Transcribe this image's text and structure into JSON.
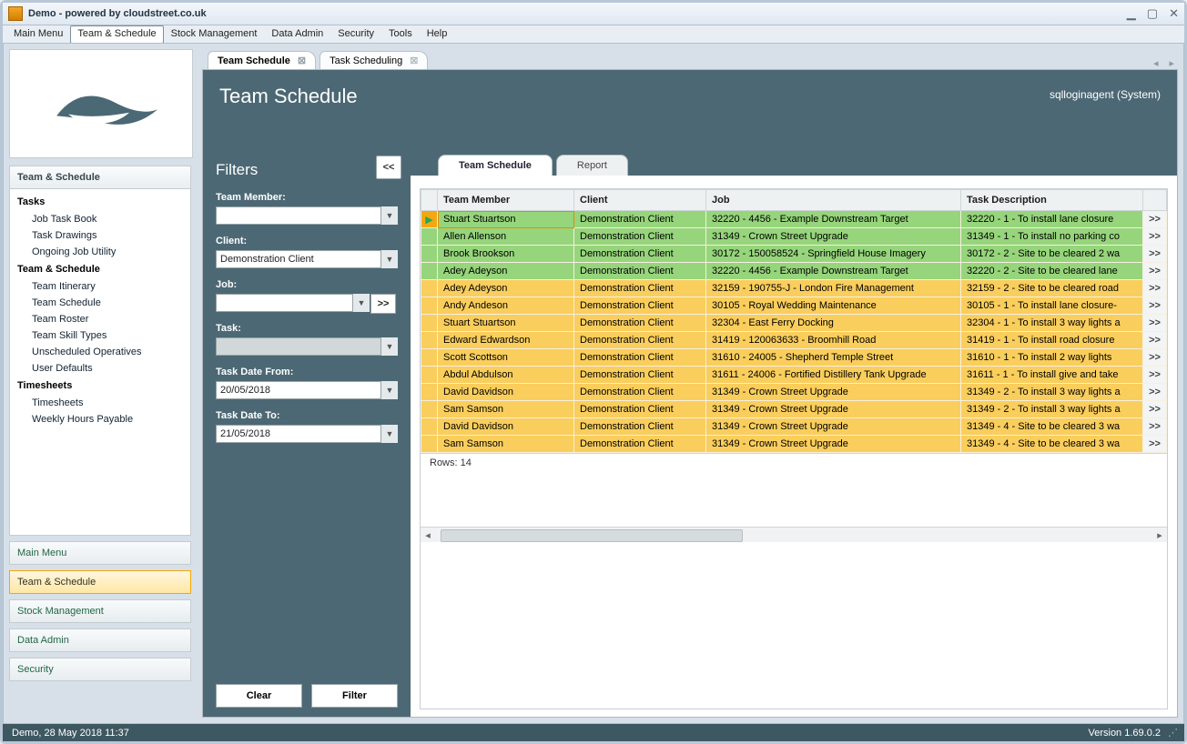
{
  "window": {
    "title": "Demo - powered by cloudstreet.co.uk"
  },
  "menubar": [
    "Main Menu",
    "Team & Schedule",
    "Stock Management",
    "Data Admin",
    "Security",
    "Tools",
    "Help"
  ],
  "menubar_active_index": 1,
  "doc_tabs": [
    {
      "label": "Team Schedule",
      "active": true
    },
    {
      "label": "Task Scheduling",
      "active": false
    }
  ],
  "page": {
    "title": "Team Schedule",
    "user": "sqlloginagent (System)"
  },
  "nav": {
    "header": "Team & Schedule",
    "groups": [
      {
        "title": "Tasks",
        "items": [
          "Job Task Book",
          "Task Drawings",
          "Ongoing Job Utility"
        ]
      },
      {
        "title": "Team & Schedule",
        "items": [
          "Team Itinerary",
          "Team Schedule",
          "Team Roster",
          "Team Skill Types",
          "Unscheduled Operatives",
          "User Defaults"
        ]
      },
      {
        "title": "Timesheets",
        "items": [
          "Timesheets",
          "Weekly Hours Payable"
        ]
      }
    ],
    "bottom": [
      {
        "label": "Main Menu",
        "selected": false
      },
      {
        "label": "Team & Schedule",
        "selected": true
      },
      {
        "label": "Stock Management",
        "selected": false
      },
      {
        "label": "Data Admin",
        "selected": false
      },
      {
        "label": "Security",
        "selected": false
      }
    ]
  },
  "filters": {
    "title": "Filters",
    "collapse": "<<",
    "team_member_label": "Team Member:",
    "team_member": "",
    "client_label": "Client:",
    "client": "Demonstration Client",
    "job_label": "Job:",
    "job": "",
    "job_go": ">>",
    "task_label": "Task:",
    "task": "",
    "date_from_label": "Task Date From:",
    "date_from": "20/05/2018",
    "date_to_label": "Task Date To:",
    "date_to": "21/05/2018",
    "clear": "Clear",
    "apply": "Filter"
  },
  "inner_tabs": [
    "Team Schedule",
    "Report"
  ],
  "grid": {
    "columns": [
      "",
      "Team Member",
      "Client",
      "Job",
      "Task Description",
      ""
    ],
    "rows": [
      {
        "c": "green",
        "sel": true,
        "tm": "Stuart Stuartson",
        "cl": "Demonstration Client",
        "job": "32220 - 4456 - Example Downstream Target",
        "td": "32220 - 1 - To install lane closure"
      },
      {
        "c": "green",
        "tm": "Allen Allenson",
        "cl": "Demonstration Client",
        "job": "31349 - Crown Street Upgrade",
        "td": "31349 - 1 - To install no parking co"
      },
      {
        "c": "green",
        "tm": "Brook Brookson",
        "cl": "Demonstration Client",
        "job": "30172 - 150058524 - Springfield House Imagery",
        "td": "30172 - 2 - Site to be cleared 2 wa"
      },
      {
        "c": "green",
        "tm": "Adey Adeyson",
        "cl": "Demonstration Client",
        "job": "32220 - 4456 - Example Downstream Target",
        "td": "32220 - 2 - Site to be cleared lane"
      },
      {
        "c": "orange",
        "tm": "Adey Adeyson",
        "cl": "Demonstration Client",
        "job": "32159 - 190755-J - London Fire Management",
        "td": "32159 - 2 - Site to be cleared road"
      },
      {
        "c": "orange",
        "tm": "Andy Andeson",
        "cl": "Demonstration Client",
        "job": "30105 - Royal Wedding Maintenance",
        "td": "30105 - 1 - To install lane closure-"
      },
      {
        "c": "orange",
        "tm": "Stuart Stuartson",
        "cl": "Demonstration Client",
        "job": "32304 - East Ferry Docking",
        "td": "32304 - 1 - To install 3 way lights a"
      },
      {
        "c": "orange",
        "tm": "Edward Edwardson",
        "cl": "Demonstration Client",
        "job": "31419 - 120063633 - Broomhill Road",
        "td": "31419 - 1 - To install road closure"
      },
      {
        "c": "orange",
        "tm": "Scott Scottson",
        "cl": "Demonstration Client",
        "job": "31610 - 24005 - Shepherd Temple Street",
        "td": "31610 - 1 - To install 2 way lights"
      },
      {
        "c": "orange",
        "tm": "Abdul Abdulson",
        "cl": "Demonstration Client",
        "job": "31611 - 24006 - Fortified Distillery Tank Upgrade",
        "td": "31611 - 1 - To install give and take"
      },
      {
        "c": "orange",
        "tm": "David Davidson",
        "cl": "Demonstration Client",
        "job": "31349 - Crown Street Upgrade",
        "td": "31349 - 2 - To install 3 way lights a"
      },
      {
        "c": "orange",
        "tm": "Sam Samson",
        "cl": "Demonstration Client",
        "job": "31349 - Crown Street Upgrade",
        "td": "31349 - 2 - To install 3 way lights a"
      },
      {
        "c": "orange",
        "tm": "David Davidson",
        "cl": "Demonstration Client",
        "job": "31349 - Crown Street Upgrade",
        "td": "31349 - 4 - Site to be cleared 3 wa"
      },
      {
        "c": "orange",
        "tm": "Sam Samson",
        "cl": "Demonstration Client",
        "job": "31349 - Crown Street Upgrade",
        "td": "31349 - 4 - Site to be cleared 3 wa"
      }
    ],
    "footer": "Rows: 14",
    "row_arrow": ">>"
  },
  "status": {
    "left": "Demo, 28 May 2018 11:37",
    "right": "Version 1.69.0.2"
  }
}
